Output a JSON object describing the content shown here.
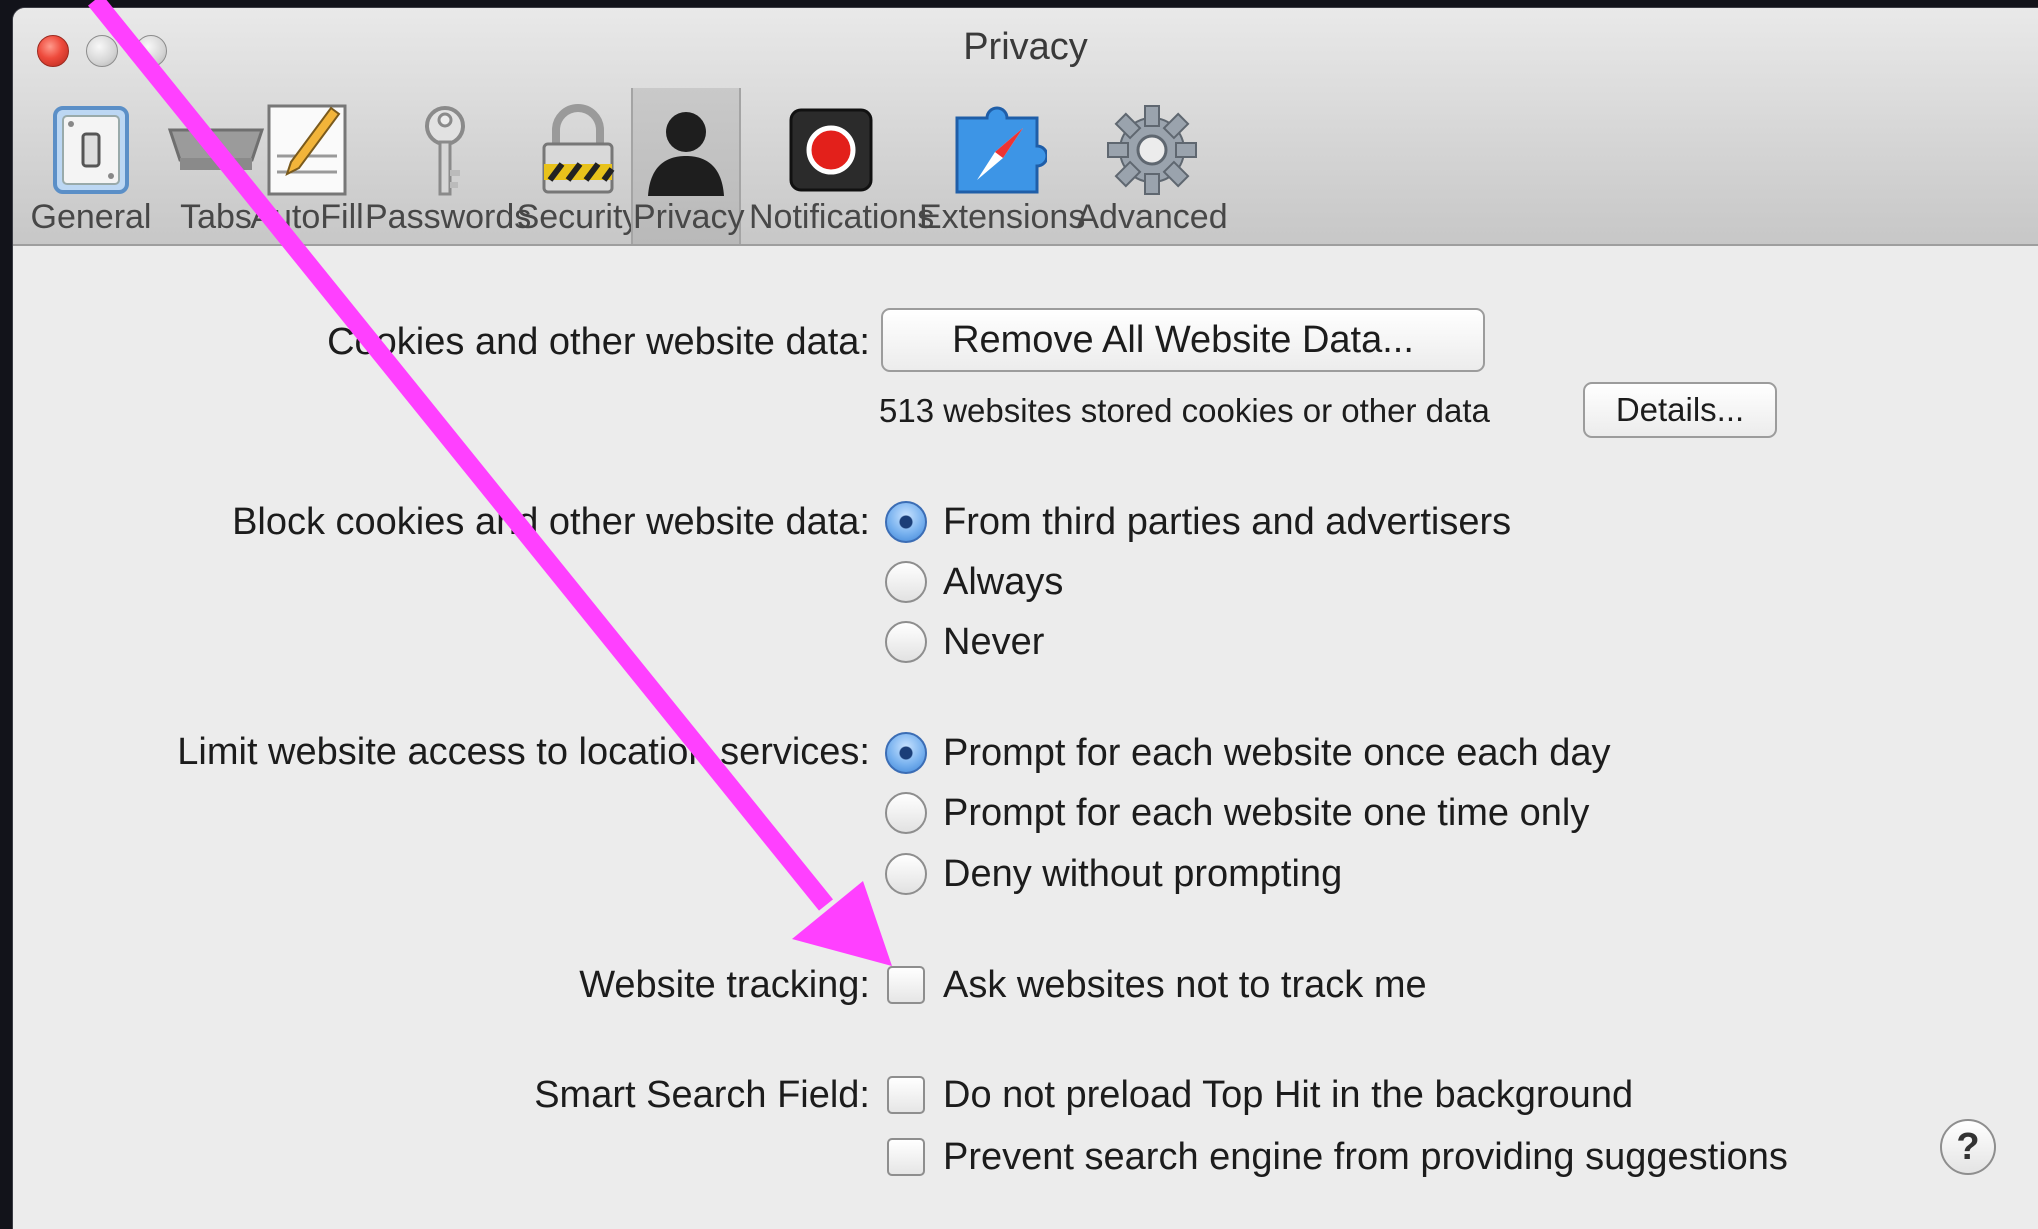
{
  "window": {
    "title": "Privacy"
  },
  "toolbar": {
    "tabs": [
      {
        "label": "General",
        "icon": "light-switch-icon"
      },
      {
        "label": "Tabs",
        "icon": "tabs-icon"
      },
      {
        "label": "AutoFill",
        "icon": "pencil-form-icon"
      },
      {
        "label": "Passwords",
        "icon": "key-icon"
      },
      {
        "label": "Security",
        "icon": "padlock-icon"
      },
      {
        "label": "Privacy",
        "icon": "person-silhouette-icon",
        "selected": true
      },
      {
        "label": "Notifications",
        "icon": "record-button-icon"
      },
      {
        "label": "Extensions",
        "icon": "puzzle-compass-icon"
      },
      {
        "label": "Advanced",
        "icon": "gear-icon"
      }
    ]
  },
  "cookies": {
    "label": "Cookies and other website data:",
    "remove_button": "Remove All Website Data...",
    "status": "513 websites stored cookies or other data",
    "details_button": "Details..."
  },
  "block_cookies": {
    "label": "Block cookies and other website data:",
    "options": [
      {
        "label": "From third parties and advertisers",
        "selected": true
      },
      {
        "label": "Always",
        "selected": false
      },
      {
        "label": "Never",
        "selected": false
      }
    ]
  },
  "location": {
    "label": "Limit website access to location services:",
    "options": [
      {
        "label": "Prompt for each website once each day",
        "selected": true
      },
      {
        "label": "Prompt for each website one time only",
        "selected": false
      },
      {
        "label": "Deny without prompting",
        "selected": false
      }
    ]
  },
  "tracking": {
    "label": "Website tracking:",
    "checkbox_label": "Ask websites not to track me",
    "checked": false
  },
  "smart_search": {
    "label": "Smart Search Field:",
    "options": [
      {
        "label": "Do not preload Top Hit in the background",
        "checked": false
      },
      {
        "label": "Prevent search engine from providing suggestions",
        "checked": false
      }
    ]
  },
  "help": {
    "glyph": "?"
  },
  "colors": {
    "annotation_arrow": "#ff40ff",
    "radio_selected": "#3d84d6"
  }
}
